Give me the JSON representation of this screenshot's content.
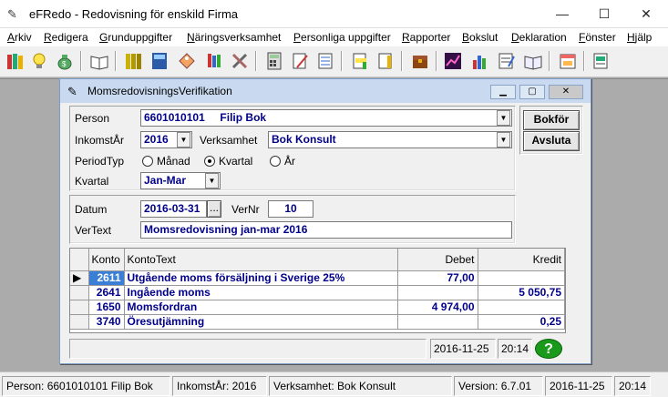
{
  "window": {
    "title": "eFRedo - Redovisning för enskild Firma",
    "minimize_glyph": "—",
    "maximize_glyph": "☐",
    "close_glyph": "✕"
  },
  "menu": [
    "Arkiv",
    "Redigera",
    "Grunduppgifter",
    "Näringsverksamhet",
    "Personliga uppgifter",
    "Rapporter",
    "Bokslut",
    "Deklaration",
    "Fönster",
    "Hjälp"
  ],
  "toolbar_icons": [
    "books-icon",
    "lightbulb-icon",
    "moneybag-icon",
    "open-book-icon",
    "binders-icon",
    "ledger-icon",
    "tag-icon",
    "pencils-icon",
    "tools-icon",
    "calculator-icon",
    "edit-document-icon",
    "list-document-icon",
    "highlight-document-icon",
    "pencil-document-icon",
    "chest-icon",
    "line-chart-icon",
    "bar-chart-icon",
    "notepad-icon",
    "book-icon",
    "calendar-icon",
    "report-icon"
  ],
  "child": {
    "title": "MomsredovisningsVerifikation",
    "person_label": "Person",
    "person_value": "6601010101     Filip Bok",
    "inkomstar_label": "InkomstÅr",
    "inkomstar_value": "2016",
    "verksamhet_label": "Verksamhet",
    "verksamhet_value": "Bok Konsult",
    "periodtyp_label": "PeriodTyp",
    "period_options": [
      "Månad",
      "Kvartal",
      "År"
    ],
    "period_selected": "Kvartal",
    "kvartal_label": "Kvartal",
    "kvartal_value": "Jan-Mar",
    "datum_label": "Datum",
    "datum_value": "2016-03-31",
    "datum_button": "...",
    "vernr_label": "VerNr",
    "vernr_value": "10",
    "vertext_label": "VerText",
    "vertext_value": "Momsredovisning jan-mar 2016",
    "bokfor_button": "Bokför",
    "avsluta_button": "Avsluta",
    "grid": {
      "headers": [
        "Konto",
        "KontoText",
        "Debet",
        "Kredit"
      ],
      "rows": [
        {
          "konto": "2611",
          "text": "Utgående moms försäljning i Sverige 25%",
          "debet": "77,00",
          "kredit": ""
        },
        {
          "konto": "2641",
          "text": "Ingående moms",
          "debet": "",
          "kredit": "5 050,75"
        },
        {
          "konto": "1650",
          "text": "Momsfordran",
          "debet": "4 974,00",
          "kredit": ""
        },
        {
          "konto": "3740",
          "text": "Öresutjämning",
          "debet": "",
          "kredit": "0,25"
        }
      ]
    },
    "status_date": "2016-11-25",
    "status_time": "20:14",
    "help_glyph": "?"
  },
  "statusbar": {
    "person": "Person: 6601010101  Filip Bok",
    "inkomstar": "InkomstÅr: 2016",
    "verksamhet": "Verksamhet: Bok Konsult",
    "version": "Version: 6.7.01",
    "date": "2016-11-25",
    "time": "20:14"
  }
}
